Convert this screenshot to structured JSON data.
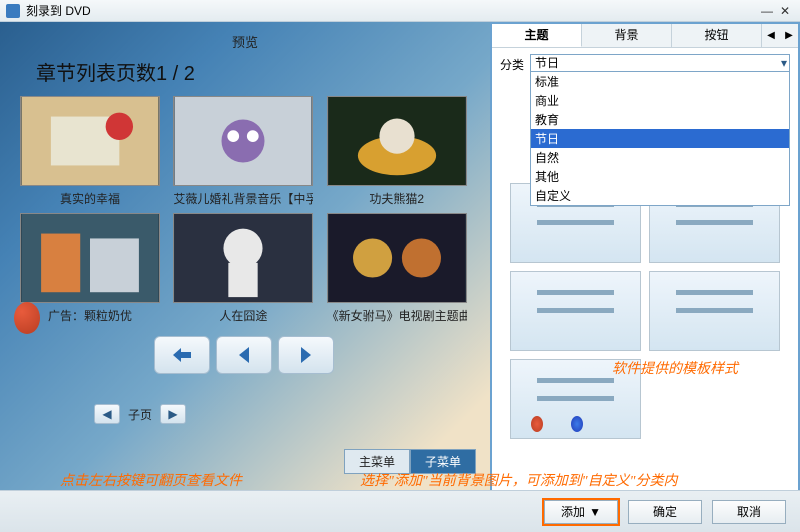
{
  "window": {
    "title": "刻录到 DVD"
  },
  "preview": {
    "header": "预览",
    "chapter_title": "章节列表页数1 / 2",
    "items": [
      {
        "caption": "真实的幸福"
      },
      {
        "caption": "艾薇儿婚礼背景音乐【中孚"
      },
      {
        "caption": "功夫熊猫2"
      },
      {
        "caption": "广告：颗粒奶优"
      },
      {
        "caption": "人在囧途"
      },
      {
        "caption": "《新女驸马》电视剧主题曲"
      }
    ],
    "subpage_label": "子页",
    "menu_main": "主菜单",
    "menu_sub": "子菜单"
  },
  "right": {
    "tabs": {
      "theme": "主题",
      "background": "背景",
      "button": "按钮"
    },
    "filter_label": "分类",
    "filter_value": "节日",
    "options": [
      "标准",
      "商业",
      "教育",
      "节日",
      "自然",
      "其他",
      "自定义"
    ]
  },
  "footer": {
    "add": "添加",
    "ok": "确定",
    "cancel": "取消"
  },
  "annotations": {
    "left_pager": "点击左右按键可翻页查看文件",
    "templates": "软件提供的模板样式",
    "add_hint": "选择\"添加\"当前背景图片，可添加到\"自定义\"分类内"
  }
}
